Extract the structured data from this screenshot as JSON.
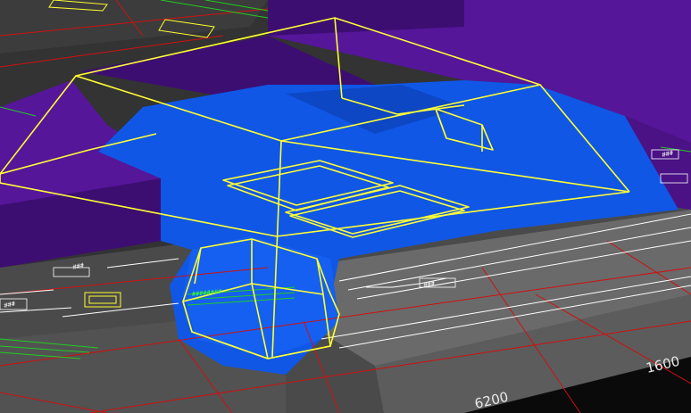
{
  "view": {
    "type": "3d-cad-viewport"
  },
  "dimensions": {
    "label_1": "6200",
    "label_2": "1600"
  },
  "colors": {
    "background": "#2e2e2e",
    "ground_dark": "#3a3a3a",
    "ground_light": "#5a5a5a",
    "slab_purple": "#55169a",
    "slab_purple_dark": "#3d0e72",
    "excavation_blue": "#1057e6",
    "wireframe_yellow": "#ffff33",
    "grid_red": "#d01010",
    "grid_green": "#22cc22",
    "line_white": "#ffffff"
  }
}
